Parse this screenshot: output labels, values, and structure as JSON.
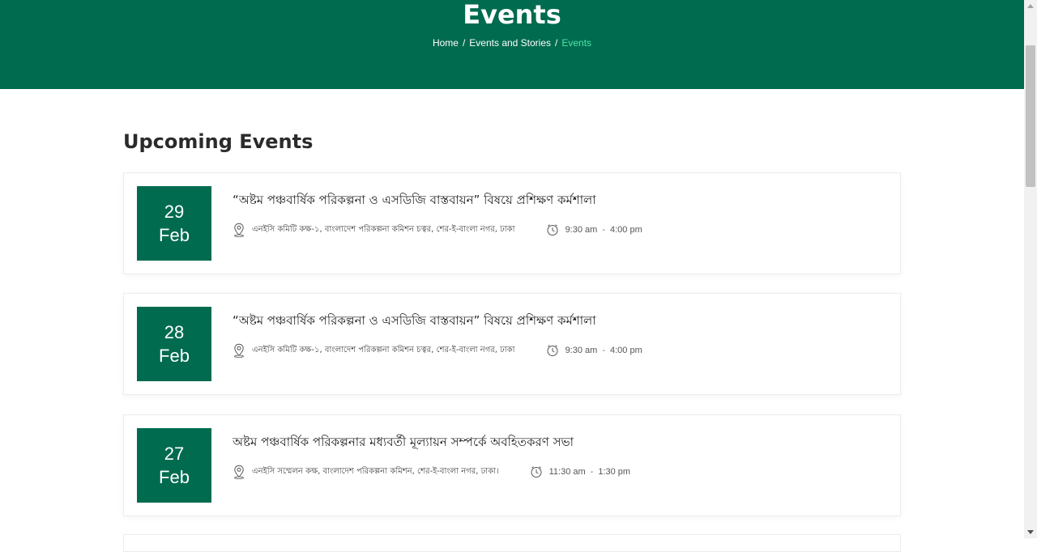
{
  "banner": {
    "title": "Events",
    "breadcrumb": {
      "home": "Home",
      "parent": "Events and Stories",
      "current": "Events",
      "separator": "/"
    },
    "color": "#006b4f",
    "current_color": "#4de6a8"
  },
  "section": {
    "title": "Upcoming Events"
  },
  "events": [
    {
      "day": "29",
      "month": "Feb",
      "title": "“অষ্টম পঞ্চবার্ষিক পরিকল্পনা ও এসডিজি বাস্তবায়ন” বিষয়ে প্রশিক্ষণ কর্মশালা",
      "location": "এনইসি কমিটি কক্ষ-১, বাংলাদেশ পরিকল্পনা কমিশন চত্বর, শের-ই-বাংলা নগর, ঢাকা",
      "start": "9:30 am",
      "end": "4:00 pm",
      "time_sep": "-",
      "location_icon": "map-pin-icon",
      "time_icon": "clock-icon"
    },
    {
      "day": "28",
      "month": "Feb",
      "title": "“অষ্টম পঞ্চবার্ষিক পরিকল্পনা ও এসডিজি বাস্তবায়ন” বিষয়ে প্রশিক্ষণ কর্মশালা",
      "location": "এনইসি কমিটি কক্ষ-১, বাংলাদেশ পরিকল্পনা কমিশন চত্বর, শের-ই-বাংলা নগর, ঢাকা",
      "start": "9:30 am",
      "end": "4:00 pm",
      "time_sep": "-",
      "location_icon": "map-pin-icon",
      "time_icon": "clock-icon"
    },
    {
      "day": "27",
      "month": "Feb",
      "title": "অষ্টম পঞ্চবার্ষিক পরিকল্পনার মধ্যবর্তী মূল্যায়ন সম্পর্কে অবহিতকরণ সভা",
      "location": "এনইসি সম্মেলন কক্ষ, বাংলাদেশ পরিকল্পনা কমিশন, শের-ই-বাংলা নগর, ঢাকা।",
      "start": "11:30 am",
      "end": "1:30 pm",
      "time_sep": "-",
      "location_icon": "map-pin-icon",
      "time_icon": "clock-icon"
    }
  ]
}
